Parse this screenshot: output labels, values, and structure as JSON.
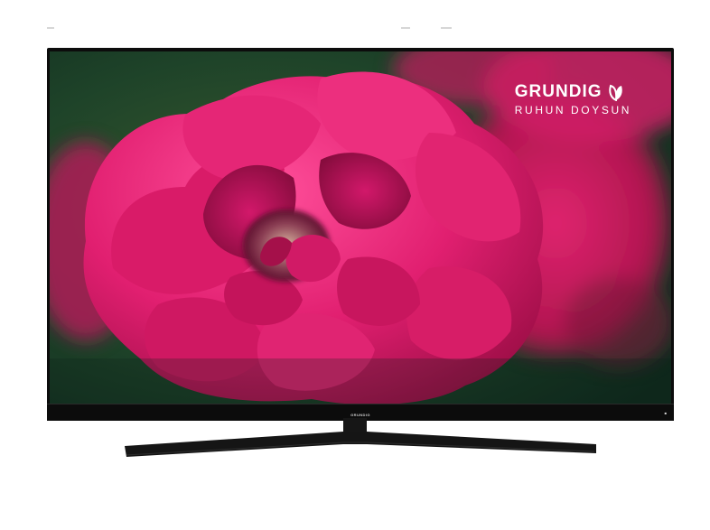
{
  "brand": {
    "name": "GRUNDIG",
    "tagline": "RUHUN DOYSUN",
    "chin_logo": "GRUNDIG"
  },
  "colors": {
    "frame": "#0c0c0c",
    "flower": "#d81a6a",
    "background": "#1f4a2f"
  },
  "icons": {
    "brand_mark": "leaf-icon"
  }
}
